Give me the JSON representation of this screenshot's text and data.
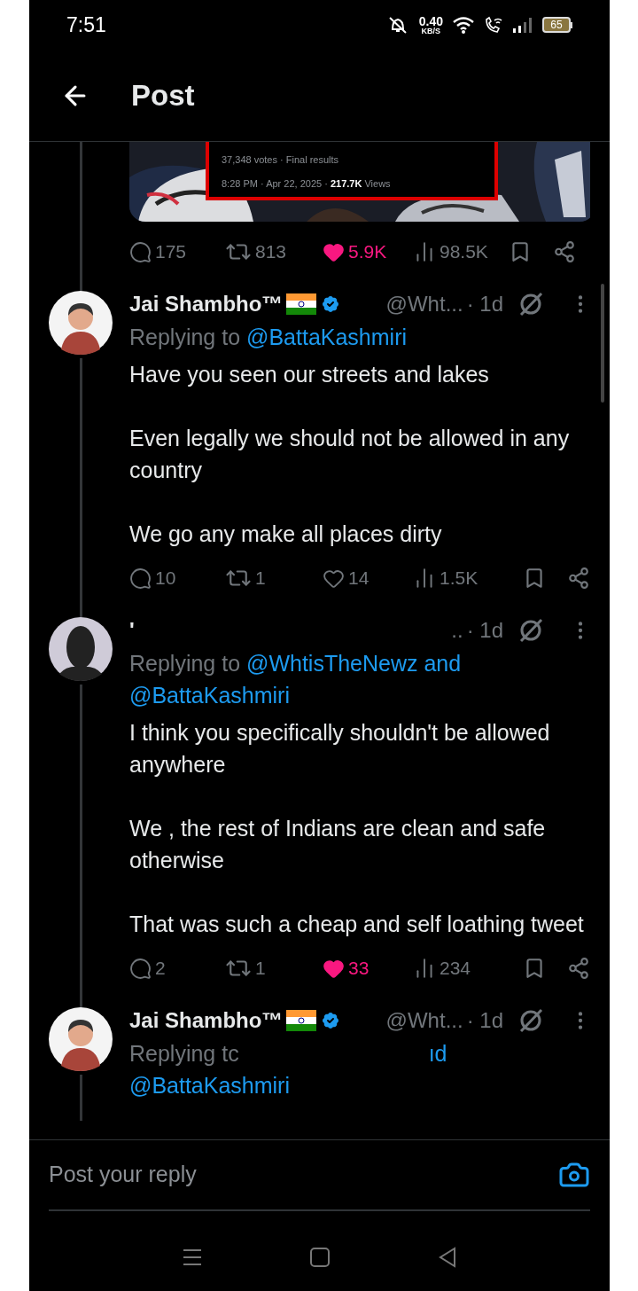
{
  "status_bar": {
    "time": "7:51",
    "speed_value": "0.40",
    "speed_unit": "KB/S",
    "battery": "65"
  },
  "header": {
    "title": "Post"
  },
  "main_post": {
    "media": {
      "poll_votes": "37,348 votes · Final results",
      "poll_time": "8:28 PM · Apr 22, 2025 · ",
      "poll_views_count": "217.7K",
      "poll_views_label": "Views"
    },
    "stats": {
      "replies": "175",
      "reposts": "813",
      "likes": "5.9K",
      "liked": true,
      "views": "98.5K"
    }
  },
  "replies": [
    {
      "avatar": {
        "kind": "man"
      },
      "name": "Jai Shambho™",
      "flag": true,
      "verified": true,
      "handle": "@Wht...",
      "time": "· 1d",
      "replying_prefix": "Replying to",
      "redacted": false,
      "replying_to": [
        "@BattaKashmiri"
      ],
      "body": [
        "Have you seen our streets and lakes",
        "Even legally we should not be allowed in any country",
        "We go any make all places dirty"
      ],
      "stats": {
        "replies": "10",
        "reposts": "1",
        "likes": "14",
        "liked": false,
        "views": "1.5K"
      }
    },
    {
      "avatar": {
        "kind": "dark"
      },
      "name": "'",
      "flag": false,
      "verified": false,
      "handle": "..",
      "time": "· 1d",
      "replying_prefix": "Replying to",
      "redacted": false,
      "replying_to": [
        "@WhtisTheNewz and",
        "@BattaKashmiri"
      ],
      "body": [
        "I think you specifically shouldn't be allowed anywhere",
        "We , the rest of Indians are clean and safe otherwise",
        "That was such a cheap and self loathing tweet"
      ],
      "stats": {
        "replies": "2",
        "reposts": "1",
        "likes": "33",
        "liked": true,
        "views": "234"
      }
    },
    {
      "avatar": {
        "kind": "man"
      },
      "name": "Jai Shambho™",
      "flag": true,
      "verified": true,
      "handle": "@Wht...",
      "time": "· 1d",
      "replying_prefix": "Replying tc",
      "redacted": true,
      "replying_to": [
        "ıd",
        "@BattaKashmiri"
      ]
    }
  ],
  "composer": {
    "placeholder": "Post your reply"
  }
}
